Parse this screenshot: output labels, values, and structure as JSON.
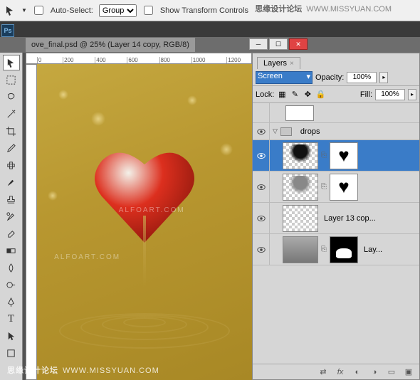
{
  "topbar": {
    "auto_select_label": "Auto-Select:",
    "group_label": "Group",
    "show_transform_label": "Show Transform Controls"
  },
  "watermarks": {
    "top_cn": "思缘设计论坛",
    "top_url": "WWW.MISSYUAN.COM",
    "canvas1": "ALFOART.COM",
    "canvas2": "ALFOART.COM",
    "bottom_cn": "思缘设计论坛",
    "bottom_url": "WWW.MISSYUAN.COM"
  },
  "doc": {
    "tab_title": "ove_final.psd @ 25% (Layer 14 copy, RGB/8)",
    "ruler_marks": [
      "0",
      "200",
      "400",
      "600",
      "800",
      "1000",
      "1200"
    ]
  },
  "toolbox": {
    "tools": [
      "move",
      "marquee",
      "lasso",
      "wand",
      "crop",
      "eyedropper",
      "healing",
      "brush",
      "stamp",
      "history-brush",
      "eraser",
      "gradient",
      "blur",
      "dodge",
      "pen",
      "type",
      "path-select",
      "rectangle"
    ]
  },
  "layers": {
    "panel_title": "Layers",
    "blend_mode": "Screen",
    "opacity_label": "Opacity:",
    "opacity_value": "100%",
    "lock_label": "Lock:",
    "fill_label": "Fill:",
    "fill_value": "100%",
    "group_name": "drops",
    "layer13_name": "Layer 13 cop...",
    "lay_name": "Lay...",
    "footer_fx": "fx"
  }
}
